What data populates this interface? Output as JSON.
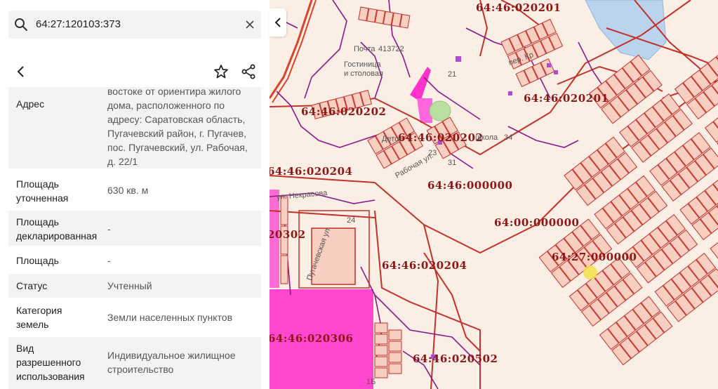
{
  "search": {
    "query": "64:27:120103:373"
  },
  "properties": {
    "address_label": "Адрес",
    "address_value": "востоке от ориентира жилого\nдома, расположенного по\nадресу: Саратовская область,\nПугачевский район, г. Пугачев,\nпос. Пугачевский, ул. Рабочая,\nд. 22/1",
    "area_clarified_label": "Площадь\nуточненная",
    "area_clarified_value": "630 кв. м",
    "area_declared_label": "Площадь\nдекларированная",
    "area_declared_value": "-",
    "area_label": "Площадь",
    "area_value": "-",
    "status_label": "Статус",
    "status_value": "Учтенный",
    "category_label": "Категория\nземель",
    "category_value": "Земли населенных пунктов",
    "use_label": "Вид\nразрешенного\nиспользования",
    "use_value": "Индивидуальное жилищное\nстроительство"
  },
  "map": {
    "labels": {
      "l1": "64:46:020201",
      "l2": "64:46:020201",
      "l3": "64:46:020202",
      "l4": "64:46:020202",
      "l5": "64:46:020204",
      "l6": "64:46:000000",
      "l7": "64:00:000000",
      "l8": "20302",
      "l9": "64:27:000000",
      "l10": "64:46:020204",
      "l11": "64:46:020306",
      "l12": "64:46:020502"
    },
    "small": {
      "post": "Почта",
      "post_code": "413722",
      "hotel1": "Гостиница",
      "hotel2": "и столовая",
      "school": "школа",
      "kinder": "Детск",
      "street1": "Рабочая ул.",
      "street2": "ул. Некрасова",
      "street3": "пер. Кр",
      "street4": "Пугачевская ул.",
      "n1": "21",
      "n2": "23",
      "n3": "24",
      "n4": "34",
      "n5": "31",
      "n6": "1Б"
    }
  },
  "colors": {
    "parcel_line": "#c4302b",
    "boundary": "#8a1a8a",
    "highlight": "#ff33cc",
    "block": "#f8cfc0"
  }
}
